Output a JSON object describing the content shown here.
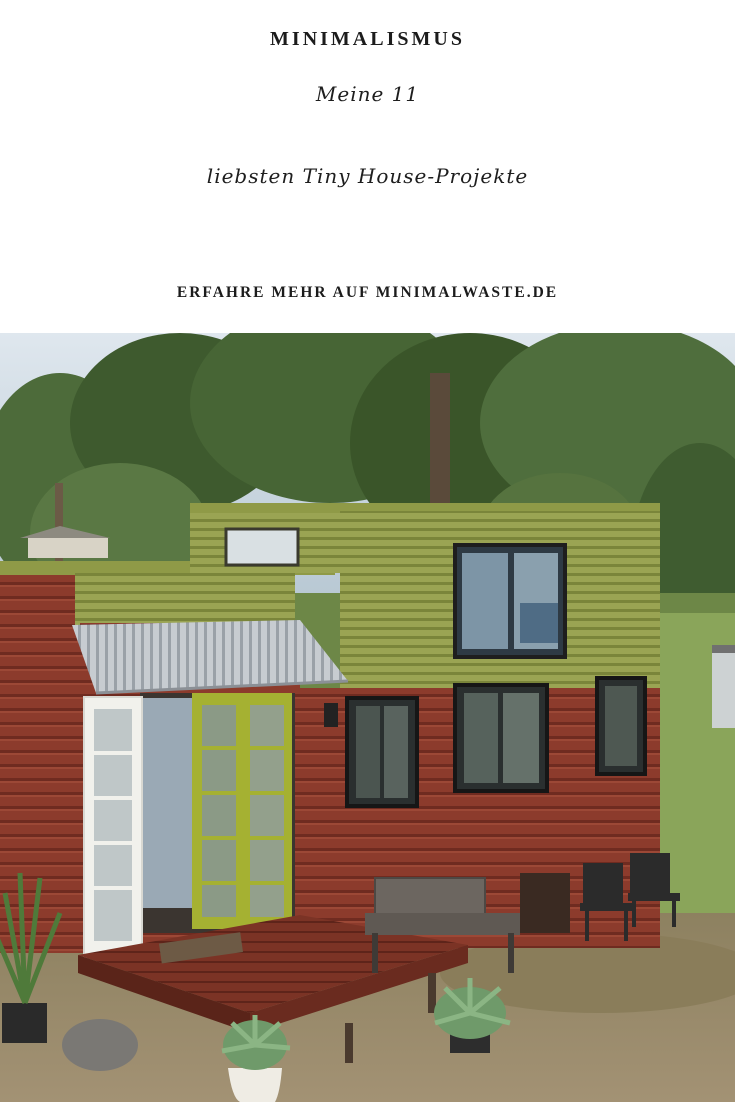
{
  "pin": {
    "kicker": "MINIMALISMUS",
    "title_line1": "Meine 11",
    "title_line2": "liebsten Tiny House-Projekte",
    "cta": "ERFAHRE MEHR AUF MINIMALWASTE.DE"
  },
  "colors": {
    "background": "#ffffff",
    "text": "#1c1c1c",
    "siding_red": "#8a3a2b",
    "siding_green": "#98a250",
    "door_green": "#a4b030",
    "sky": "#c9d7e0"
  },
  "icons": [
    "tiny-house-photo"
  ]
}
